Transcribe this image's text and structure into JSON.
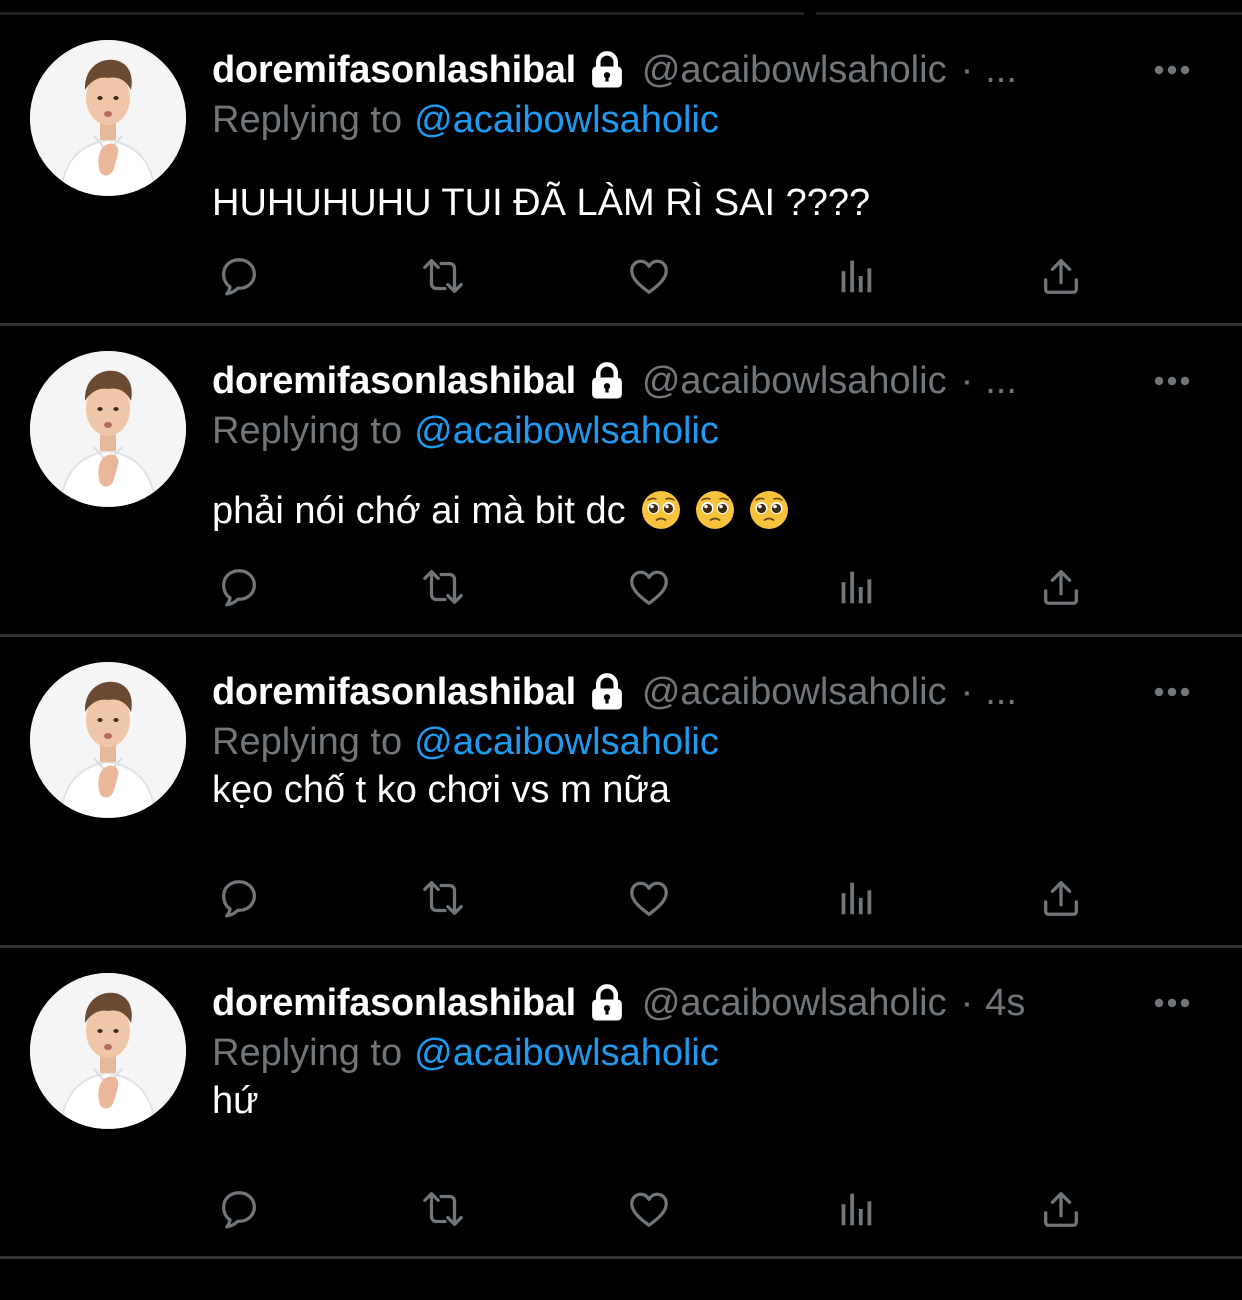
{
  "colors": {
    "background": "#000000",
    "divider": "#2f3336",
    "primary_text": "#ffffff",
    "secondary_text": "#71767b",
    "link": "#1d9bf0"
  },
  "icons": {
    "lock": "lock-icon",
    "more": "more-horizontal-icon",
    "reply": "reply-bubble-icon",
    "retweet": "retweet-icon",
    "like": "heart-icon",
    "views": "analytics-bars-icon",
    "share": "share-upload-icon",
    "emoji": "pleading-face-emoji"
  },
  "tweets": [
    {
      "display_name": "doremifasonlashibal",
      "handle": "@acaibowlsaholic",
      "separator": "·",
      "time": "...",
      "reply_prefix": "Replying to",
      "reply_to": "@acaibowlsaholic",
      "text": "HUHUHUHU TUI ĐÃ LÀM RÌ SAI ????",
      "emoji_count": 0
    },
    {
      "display_name": "doremifasonlashibal",
      "handle": "@acaibowlsaholic",
      "separator": "·",
      "time": "...",
      "reply_prefix": "Replying to",
      "reply_to": "@acaibowlsaholic",
      "text": "phải nói chớ ai mà bit dc",
      "emoji_count": 3
    },
    {
      "display_name": "doremifasonlashibal",
      "handle": "@acaibowlsaholic",
      "separator": "·",
      "time": "...",
      "reply_prefix": "Replying to",
      "reply_to": "@acaibowlsaholic",
      "text": "kẹo chố t ko chơi vs m nữa",
      "emoji_count": 0
    },
    {
      "display_name": "doremifasonlashibal",
      "handle": "@acaibowlsaholic",
      "separator": "·",
      "time": "4s",
      "reply_prefix": "Replying to",
      "reply_to": "@acaibowlsaholic",
      "text": "hứ",
      "emoji_count": 0
    }
  ]
}
